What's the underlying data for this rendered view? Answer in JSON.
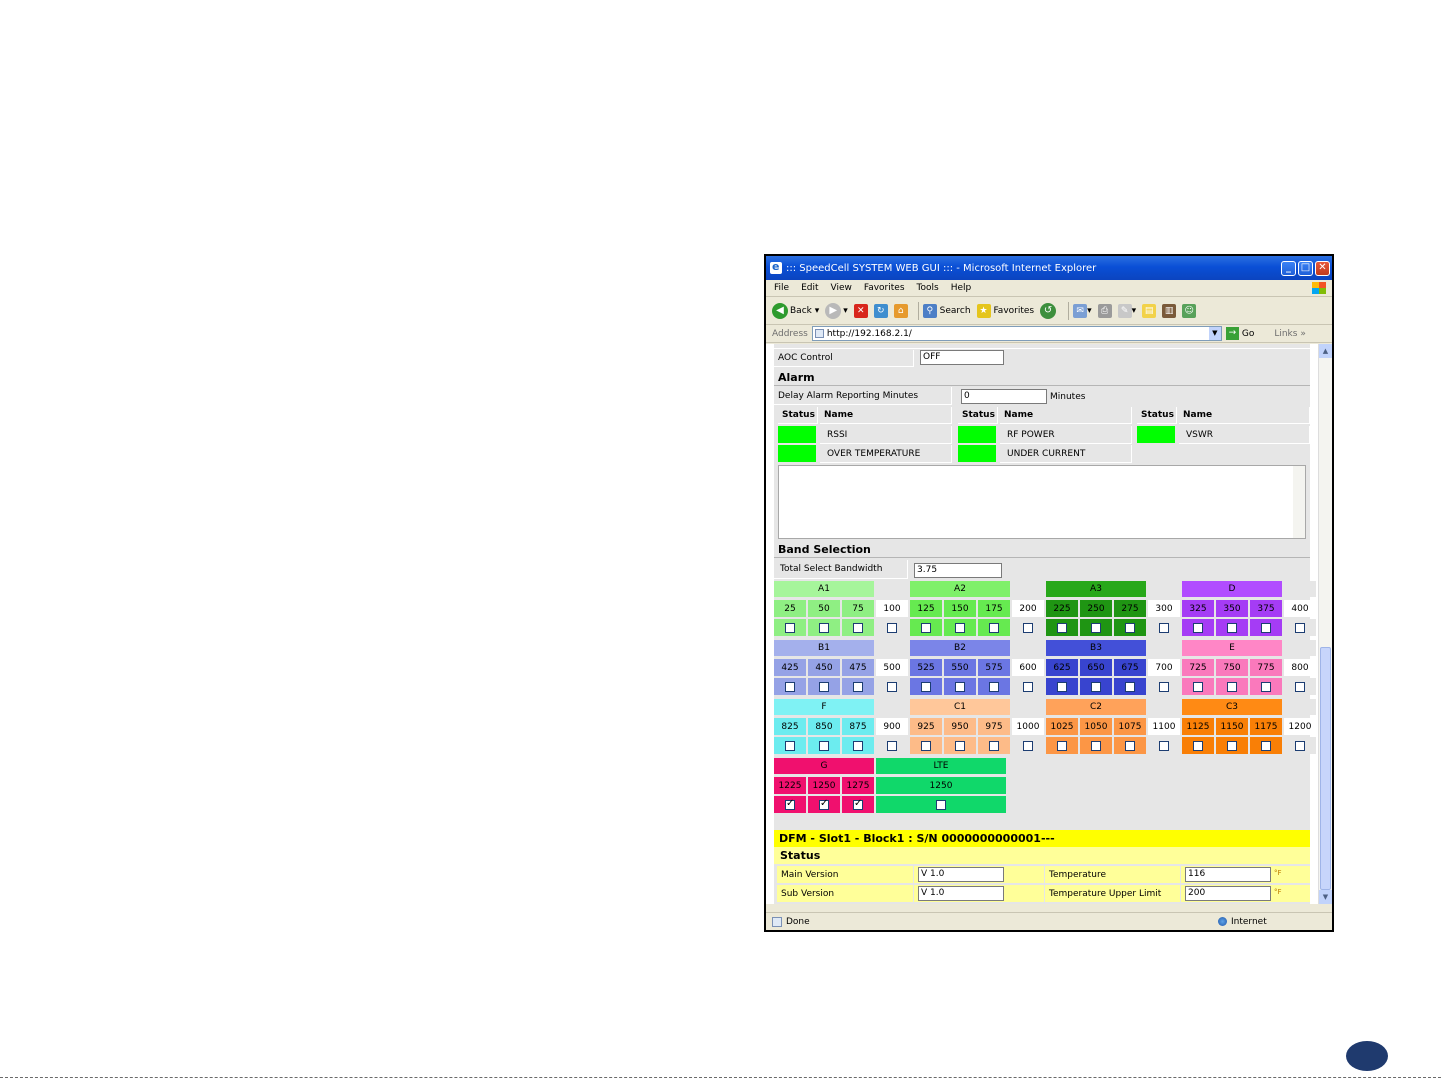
{
  "browser": {
    "title": "::: SpeedCell SYSTEM WEB GUI ::: - Microsoft Internet Explorer",
    "menu": [
      "File",
      "Edit",
      "View",
      "Favorites",
      "Tools",
      "Help"
    ],
    "toolbar": {
      "back": "Back",
      "search": "Search",
      "favorites": "Favorites"
    },
    "address_label": "Address",
    "address": "http://192.168.2.1/",
    "go": "Go",
    "links": "Links",
    "status_text": "Done",
    "zone": "Internet"
  },
  "aoc": {
    "label": "AOC Control",
    "value": "OFF"
  },
  "alarm": {
    "title": "Alarm",
    "delay_label": "Delay Alarm Reporting Minutes",
    "delay_value": "0",
    "delay_unit": "Minutes",
    "status_header": "Status",
    "name_header": "Name",
    "items": [
      "RSSI",
      "RF POWER",
      "VSWR",
      "OVER TEMPERATURE",
      "UNDER CURRENT"
    ],
    "status_color": "#00ff00"
  },
  "band": {
    "title": "Band Selection",
    "total_label": "Total Select Bandwidth",
    "total_value": "3.75"
  },
  "bands": {
    "A1": "A1",
    "A2": "A2",
    "A3": "A3",
    "D": "D",
    "B1": "B1",
    "B2": "B2",
    "B3": "B3",
    "E": "E",
    "F": "F",
    "C1": "C1",
    "C2": "C2",
    "C3": "C3",
    "G": "G",
    "LTE": "LTE"
  },
  "band_rows": [
    [
      "25",
      "50",
      "75",
      "100",
      "125",
      "150",
      "175",
      "200",
      "225",
      "250",
      "275",
      "300",
      "325",
      "350",
      "375",
      "400"
    ],
    [
      "425",
      "450",
      "475",
      "500",
      "525",
      "550",
      "575",
      "600",
      "625",
      "650",
      "675",
      "700",
      "725",
      "750",
      "775",
      "800"
    ],
    [
      "825",
      "850",
      "875",
      "900",
      "925",
      "950",
      "975",
      "1000",
      "1025",
      "1050",
      "1075",
      "1100",
      "1125",
      "1150",
      "1175",
      "1200"
    ]
  ],
  "g_values": [
    "1225",
    "1250",
    "1275"
  ],
  "lte_value": "1250",
  "dfm": {
    "title": "DFM - Slot1 - Block1 : S/N 0000000000001---",
    "status_label": "Status",
    "main_version_label": "Main Version",
    "main_version": "V 1.0",
    "sub_version_label": "Sub Version",
    "sub_version": "V 1.0",
    "temp_label": "Temperature",
    "temp_value": "116",
    "temp_limit_label": "Temperature Upper Limit",
    "temp_limit_value": "200",
    "temp_unit": "°F"
  }
}
